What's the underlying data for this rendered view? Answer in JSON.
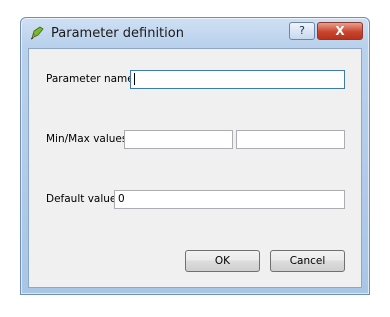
{
  "window": {
    "title": "Parameter definition",
    "help_label": "?",
    "close_label": "X"
  },
  "form": {
    "param_name_label": "Parameter name",
    "param_name_value": "",
    "minmax_label": "Min/Max values",
    "min_value": "",
    "max_value": "",
    "default_label": "Default value",
    "default_value": "0"
  },
  "buttons": {
    "ok_label": "OK",
    "cancel_label": "Cancel"
  },
  "colors": {
    "title_bar": "#b9d1ec",
    "close_button": "#c9452d",
    "dialog_body": "#f0f0f0"
  },
  "icons": {
    "app_icon": "qgis-pencil-icon"
  }
}
